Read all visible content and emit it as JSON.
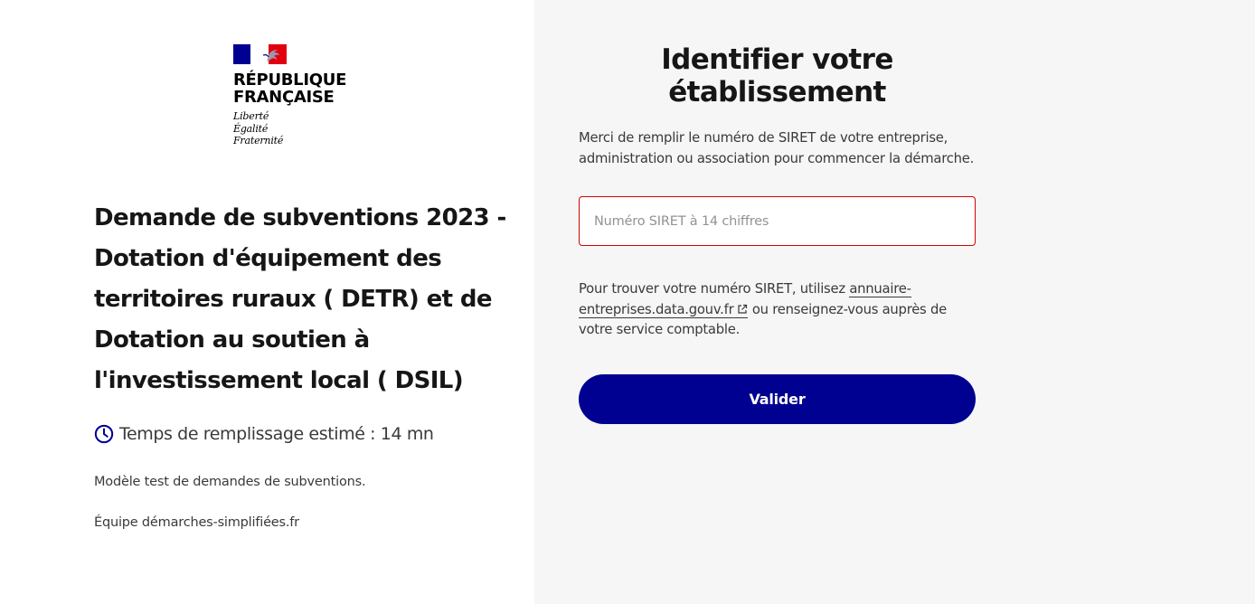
{
  "logo": {
    "title_line1": "République",
    "title_line2": "Française",
    "motto_line1": "Liberté",
    "motto_line2": "Égalité",
    "motto_line3": "Fraternité",
    "colors": {
      "blue": "#000091",
      "red": "#e1000f"
    }
  },
  "procedure": {
    "title": "Demande de subventions 2023 - Dotation d'équipement des territoires ruraux ( DETR) et de Dotation au soutien à l'investissement local ( DSIL)",
    "duration_icon": "clock-icon",
    "duration": "Temps de remplissage estimé : 14 mn",
    "description": "Modèle test de demandes de subventions.",
    "team": "Équipe démarches-simplifiées.fr"
  },
  "form": {
    "title": "Identifier votre établissement",
    "intro": "Merci de remplir le numéro de SIRET de votre entreprise, administration ou association pour commencer la démarche.",
    "siret_placeholder": "Numéro SIRET à 14 chiffres",
    "siret_value": "",
    "help_before": "Pour trouver votre numéro SIRET, utilisez ",
    "help_link": "annuaire-entreprises.data.gouv.fr",
    "help_link_icon": "external-link-icon",
    "help_after": " ou renseignez-vous auprès de votre service comptable.",
    "submit_label": "Valider",
    "accent_color": "#000091",
    "error_border_color": "#ce0500"
  }
}
